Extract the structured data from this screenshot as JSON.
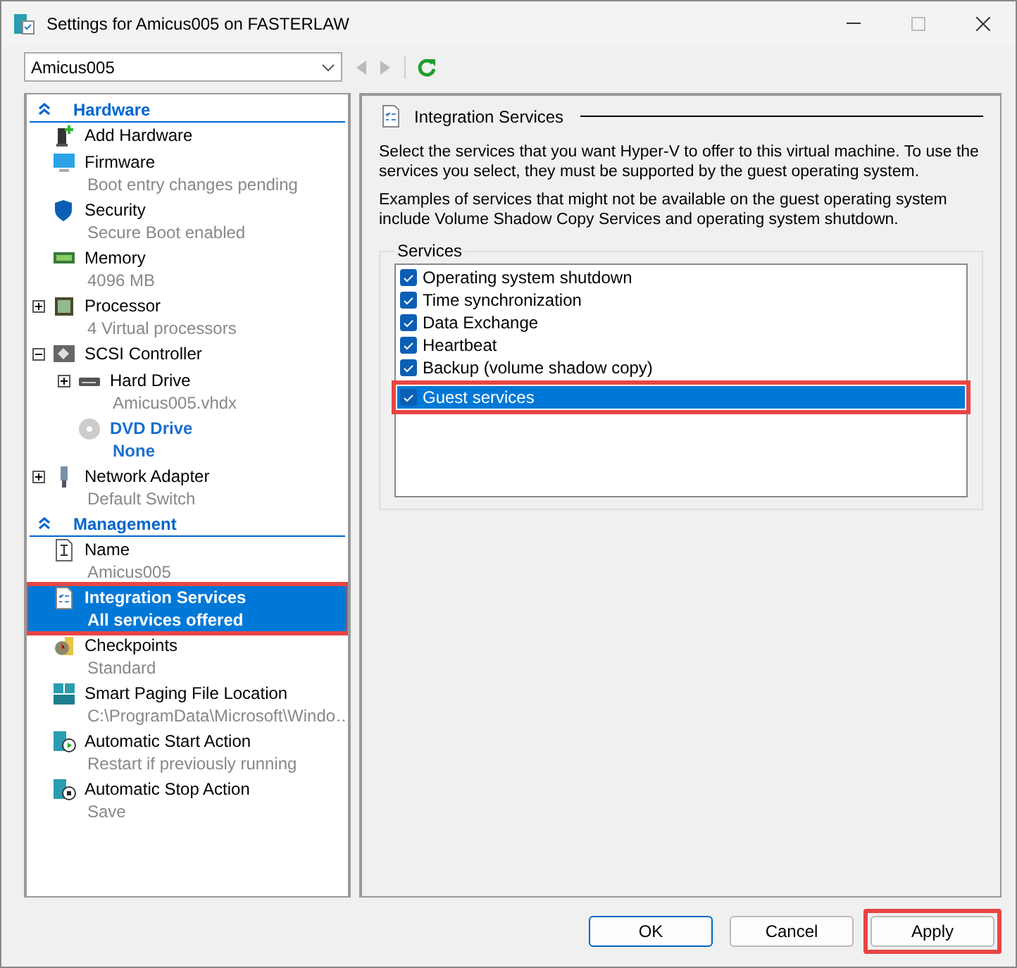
{
  "window": {
    "title": "Settings for Amicus005 on FASTERLAW"
  },
  "toolbar": {
    "vm_select": "Amicus005"
  },
  "sidebar": {
    "sections": [
      {
        "title": "Hardware",
        "expanded": true,
        "items": [
          {
            "label": "Add Hardware",
            "selected": false
          },
          {
            "label": "Firmware",
            "detail": "Boot entry changes pending",
            "selected": false
          },
          {
            "label": "Security",
            "detail": "Secure Boot enabled",
            "selected": false
          },
          {
            "label": "Memory",
            "detail": "4096 MB",
            "selected": false
          },
          {
            "label": "Processor",
            "detail": "4 Virtual processors",
            "expanded": false,
            "selected": false
          },
          {
            "label": "SCSI Controller",
            "expanded": true,
            "selected": false,
            "children": [
              {
                "label": "Hard Drive",
                "detail": "Amicus005.vhdx",
                "expanded": false,
                "selected": false
              },
              {
                "label": "DVD Drive",
                "detail": "None",
                "emphasized": true,
                "selected": false
              }
            ]
          },
          {
            "label": "Network Adapter",
            "detail": "Default Switch",
            "expanded": false,
            "selected": false
          }
        ]
      },
      {
        "title": "Management",
        "expanded": true,
        "items": [
          {
            "label": "Name",
            "detail": "Amicus005",
            "selected": false
          },
          {
            "label": "Integration Services",
            "detail": "All services offered",
            "selected": true,
            "highlighted": true
          },
          {
            "label": "Checkpoints",
            "detail": "Standard",
            "selected": false
          },
          {
            "label": "Smart Paging File Location",
            "detail": "C:\\ProgramData\\Microsoft\\Windo…",
            "selected": false
          },
          {
            "label": "Automatic Start Action",
            "detail": "Restart if previously running",
            "selected": false
          },
          {
            "label": "Automatic Stop Action",
            "detail": "Save",
            "selected": false
          }
        ]
      }
    ]
  },
  "panel": {
    "title": "Integration Services",
    "paragraphs": [
      "Select the services that you want Hyper-V to offer to this virtual machine. To use the services you select, they must be supported by the guest operating system.",
      "Examples of services that might not be available on the guest operating system include Volume Shadow Copy Services and operating system shutdown."
    ],
    "services_label": "Services",
    "services": [
      {
        "label": "Operating system shutdown",
        "checked": true,
        "selected": false
      },
      {
        "label": "Time synchronization",
        "checked": true,
        "selected": false
      },
      {
        "label": "Data Exchange",
        "checked": true,
        "selected": false
      },
      {
        "label": "Heartbeat",
        "checked": true,
        "selected": false
      },
      {
        "label": "Backup (volume shadow copy)",
        "checked": true,
        "selected": false
      },
      {
        "label": "Guest services",
        "checked": true,
        "selected": true,
        "highlighted": true
      }
    ]
  },
  "buttons": [
    {
      "label": "OK",
      "kind": "default",
      "highlighted": false
    },
    {
      "label": "Cancel",
      "kind": "normal",
      "highlighted": false
    },
    {
      "label": "Apply",
      "kind": "normal",
      "highlighted": true
    }
  ]
}
